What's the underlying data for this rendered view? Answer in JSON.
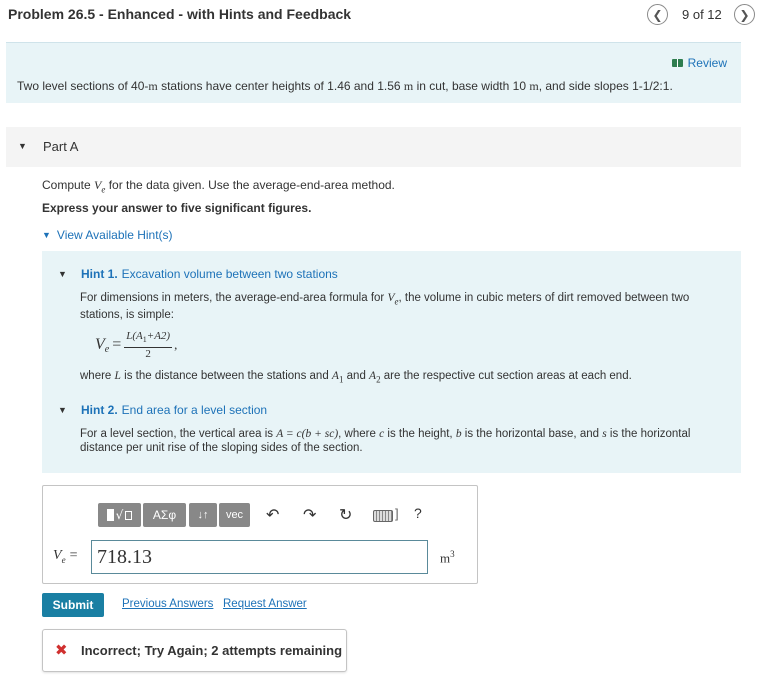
{
  "header": {
    "title": "Problem 26.5 - Enhanced - with Hints and Feedback",
    "counter": "9 of 12",
    "prev_icon": "chevron-left-icon",
    "next_icon": "chevron-right-icon"
  },
  "problem": {
    "review_label": "Review",
    "text_1": "Two level sections of 40-",
    "unit_m_1": "m",
    "text_2": " stations have center heights of 1.46 and 1.56 ",
    "unit_m_2": "m",
    "text_3": " in cut, base width 10 ",
    "unit_m_3": "m",
    "text_4": ", and side slopes 1-1/2:1."
  },
  "part": {
    "label": "Part A",
    "instruction_pre": "Compute ",
    "instruction_var": "V",
    "instruction_sub": "e",
    "instruction_post": " for the data given. Use the average-end-area method.",
    "instruction_bold": "Express your answer to five significant figures.",
    "hints_toggle": "View Available Hint(s)"
  },
  "hints": [
    {
      "number": "Hint 1.",
      "title": "Excavation volume between two stations",
      "text_pre": "For dimensions in meters, the average-end-area formula for ",
      "text_var": "V",
      "text_sub": "e",
      "text_post": ", the volume in cubic meters of dirt removed between two stations, is simple:",
      "formula_lhs": "V",
      "formula_lhs_sub": "e",
      "formula_numerator": "L(A",
      "formula_num_sub1": "1",
      "formula_num_mid": "+A2)",
      "formula_denominator": "2",
      "where_pre": "where ",
      "where_L": "L",
      "where_mid1": " is the distance between the stations and ",
      "where_A1": "A",
      "where_A1_sub": "1",
      "where_and": " and ",
      "where_A2": "A",
      "where_A2_sub": "2",
      "where_post": " are the respective cut section areas at each end."
    },
    {
      "number": "Hint 2.",
      "title": "End area for a level section",
      "text_pre": "For a level section, the vertical area is ",
      "formula": "A = c(b + sc)",
      "text_mid1": ", where ",
      "var_c": "c",
      "text_mid2": " is the height, ",
      "var_b": "b",
      "text_mid3": " is the horizontal base, and ",
      "var_s": "s",
      "text_post": " is the horizontal distance per unit rise of the sloping sides of the section."
    }
  ],
  "toolbar": {
    "template_icon": "template-icon",
    "greek_label": "ΑΣφ",
    "arrows_label": "↓↑",
    "vec_label": "vec",
    "undo_icon": "undo-icon",
    "redo_icon": "redo-icon",
    "reset_icon": "reset-icon",
    "keyboard_icon": "keyboard-icon",
    "help_label": "?"
  },
  "answer": {
    "var": "V",
    "var_sub": "e",
    "equals": "=",
    "value": "718.13",
    "unit": "m",
    "unit_exp": "3"
  },
  "actions": {
    "submit_label": "Submit",
    "previous_answers": "Previous Answers",
    "request_answer": "Request Answer"
  },
  "feedback": {
    "icon": "x-icon",
    "text": "Incorrect; Try Again; 2 attempts remaining",
    "color": "#d0302f"
  },
  "colors": {
    "accent": "#1d72b8",
    "submit": "#1a7fa3",
    "panel_bg": "#e8f4f7"
  }
}
